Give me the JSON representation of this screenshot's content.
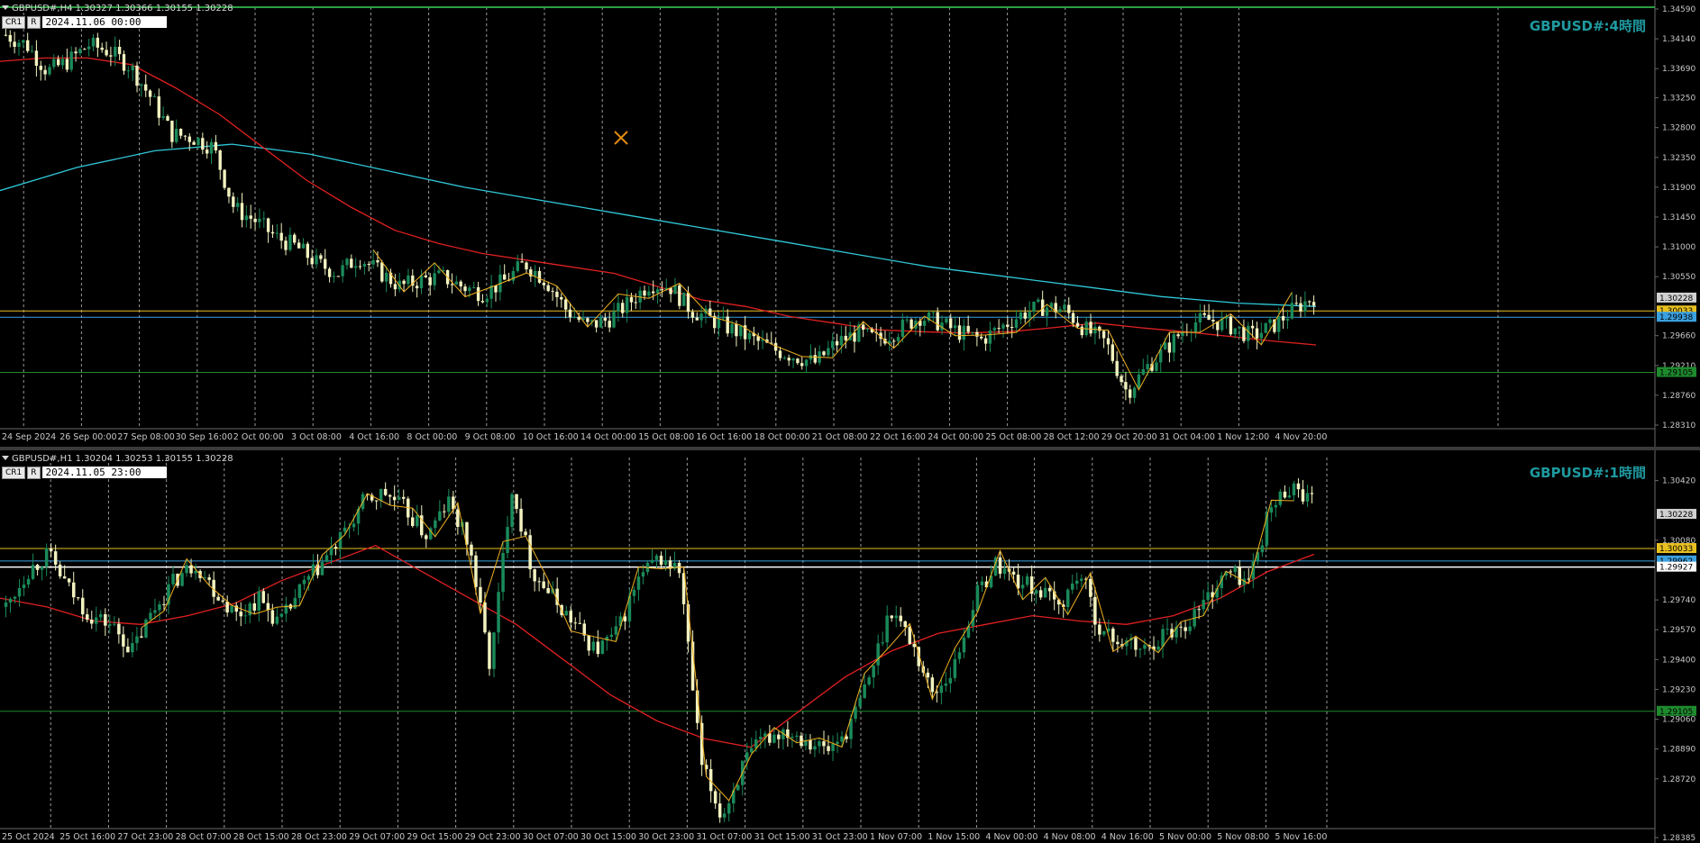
{
  "pane1": {
    "header": "GBPUSD#,H4  1.30327 1.30366 1.30155 1.30228",
    "buttons": [
      "CR1",
      "R"
    ],
    "date": "2024.11.06 00:00",
    "watermark": "GBPUSD#:4時間",
    "price_labels": [
      "1.34590",
      "1.34140",
      "1.33690",
      "1.33250",
      "1.32800",
      "1.32350",
      "1.31900",
      "1.31450",
      "1.31000",
      "1.30550",
      "1.29660",
      "1.29210",
      "1.28760",
      "1.28310"
    ],
    "time_labels": [
      "24 Sep 2024",
      "26 Sep 00:00",
      "27 Sep 08:00",
      "30 Sep 16:00",
      "2 Oct 00:00",
      "3 Oct 08:00",
      "4 Oct 16:00",
      "8 Oct 00:00",
      "9 Oct 08:00",
      "10 Oct 16:00",
      "14 Oct 00:00",
      "15 Oct 08:00",
      "16 Oct 16:00",
      "18 Oct 00:00",
      "21 Oct 08:00",
      "22 Oct 16:00",
      "24 Oct 00:00",
      "25 Oct 08:00",
      "28 Oct 12:00",
      "29 Oct 20:00",
      "31 Oct 04:00",
      "1 Nov 12:00",
      "4 Nov 20:00"
    ],
    "tags": {
      "current": "1.30228",
      "yellow": "1.30033",
      "blue": "1.29938",
      "green": "1.29105"
    }
  },
  "pane2": {
    "header": "GBPUSD#,H1  1.30204 1.30253 1.30155 1.30228",
    "buttons": [
      "CR1",
      "R"
    ],
    "date": "2024.11.05 23:00",
    "watermark": "GBPUSD#:1時間",
    "price_labels": [
      "1.30420",
      "1.30080",
      "1.29740",
      "1.29570",
      "1.29400",
      "1.29230",
      "1.29060",
      "1.28890",
      "1.28720",
      "1.28385"
    ],
    "time_labels": [
      "25 Oct 2024",
      "25 Oct 16:00",
      "27 Oct 23:00",
      "28 Oct 07:00",
      "28 Oct 15:00",
      "28 Oct 23:00",
      "29 Oct 07:00",
      "29 Oct 15:00",
      "29 Oct 23:00",
      "30 Oct 07:00",
      "30 Oct 15:00",
      "30 Oct 23:00",
      "31 Oct 07:00",
      "31 Oct 15:00",
      "31 Oct 23:00",
      "1 Nov 07:00",
      "1 Nov 15:00",
      "4 Nov 00:00",
      "4 Nov 08:00",
      "4 Nov 16:00",
      "5 Nov 00:00",
      "5 Nov 08:00",
      "5 Nov 16:00"
    ],
    "tags": {
      "current": "1.30228",
      "yellow": "1.30033",
      "blue": "1.29962",
      "white": "1.29927",
      "green": "1.29105"
    }
  },
  "colors": {
    "bull": "#1a8a5a",
    "bear": "#f2f2c0",
    "ma_red": "#e02020",
    "ma_cyan": "#30c8d8",
    "zigzag": "#f0b020",
    "level_yellow": "#e8c020",
    "level_blue": "#3aa0e0",
    "level_green": "#1e8a2e",
    "grid": "#9a9a9a"
  },
  "chart_data": [
    {
      "type": "candlestick",
      "symbol": "GBPUSD#",
      "timeframe": "H4",
      "ylim": [
        1.2831,
        1.3459
      ],
      "price_path": [
        1.342,
        1.3405,
        1.3365,
        1.338,
        1.3405,
        1.3395,
        1.3372,
        1.3325,
        1.327,
        1.3265,
        1.325,
        1.3158,
        1.314,
        1.3115,
        1.31,
        1.3075,
        1.306,
        1.3085,
        1.3062,
        1.304,
        1.305,
        1.3055,
        1.304,
        1.303,
        1.3048,
        1.3075,
        1.305,
        1.3005,
        1.298,
        1.299,
        1.3015,
        1.3045,
        1.304,
        1.3005,
        1.299,
        1.2975,
        1.296,
        1.2945,
        1.2935,
        1.2925,
        1.2955,
        1.297,
        1.296,
        1.2975,
        1.2995,
        1.2985,
        1.297,
        1.296,
        1.298,
        1.3,
        1.301,
        1.3005,
        1.2975,
        1.2955,
        1.288,
        1.292,
        1.295,
        1.2985,
        1.299,
        1.298,
        1.2965,
        1.298,
        1.3005,
        1.3025
      ],
      "ma_red": [
        1.338,
        1.3385,
        1.3385,
        1.3375,
        1.334,
        1.33,
        1.325,
        1.32,
        1.316,
        1.3125,
        1.3105,
        1.309,
        1.308,
        1.307,
        1.306,
        1.304,
        1.302,
        1.301,
        1.2995,
        1.2985,
        1.2975,
        1.2972,
        1.297,
        1.2972,
        1.2978,
        1.2985,
        1.2978,
        1.2972,
        1.2965,
        1.2958,
        1.2952
      ],
      "ma_cyan": [
        1.3185,
        1.322,
        1.3245,
        1.3255,
        1.324,
        1.3215,
        1.319,
        1.317,
        1.315,
        1.313,
        1.311,
        1.309,
        1.307,
        1.3055,
        1.304,
        1.3025,
        1.3015,
        1.301
      ],
      "levels": {
        "yellow": 1.30033,
        "blue": 1.29938,
        "green": 1.29105
      }
    },
    {
      "type": "candlestick",
      "symbol": "GBPUSD#",
      "timeframe": "H1",
      "ylim": [
        1.28385,
        1.3049
      ],
      "price_path": [
        1.297,
        1.299,
        1.3,
        1.298,
        1.2965,
        1.296,
        1.2945,
        1.2968,
        1.2985,
        1.2995,
        1.2978,
        1.2965,
        1.2975,
        1.296,
        1.298,
        1.2995,
        1.301,
        1.303,
        1.3035,
        1.3025,
        1.301,
        1.303,
        1.3005,
        1.2935,
        1.304,
        1.299,
        1.2975,
        1.296,
        1.2945,
        1.2955,
        1.2985,
        1.2998,
        1.299,
        1.288,
        1.285,
        1.288,
        1.2895,
        1.29,
        1.2895,
        1.2888,
        1.29,
        1.293,
        1.297,
        1.295,
        1.292,
        1.2935,
        1.2975,
        1.2995,
        1.2985,
        1.298,
        1.297,
        1.299,
        1.2955,
        1.295,
        1.2945,
        1.2955,
        1.296,
        1.2975,
        1.299,
        1.2985,
        1.3025,
        1.304,
        1.303
      ],
      "ma_red": [
        1.2975,
        1.297,
        1.2962,
        1.296,
        1.2965,
        1.2972,
        1.2985,
        1.2995,
        1.3005,
        1.299,
        1.2975,
        1.296,
        1.294,
        1.292,
        1.2905,
        1.2895,
        1.289,
        1.291,
        1.293,
        1.2945,
        1.2955,
        1.296,
        1.2965,
        1.2962,
        1.296,
        1.2965,
        1.2975,
        1.299,
        1.3
      ],
      "levels": {
        "yellow": 1.30033,
        "blue": 1.29962,
        "white": 1.29927,
        "green": 1.29105
      }
    }
  ]
}
